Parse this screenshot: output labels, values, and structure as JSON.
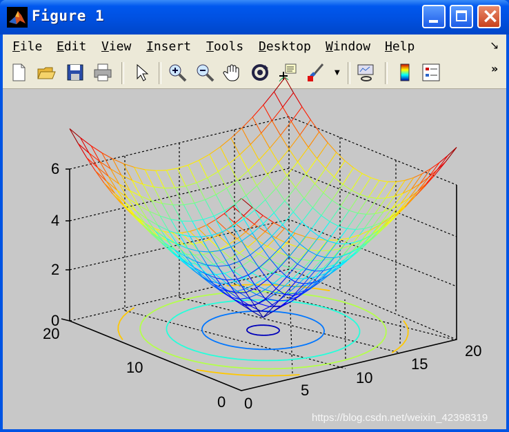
{
  "window": {
    "title": "Figure 1"
  },
  "menu": [
    {
      "label": "File",
      "mnemonic": "F",
      "rest": "ile"
    },
    {
      "label": "Edit",
      "mnemonic": "E",
      "rest": "dit"
    },
    {
      "label": "View",
      "mnemonic": "V",
      "rest": "iew"
    },
    {
      "label": "Insert",
      "mnemonic": "I",
      "rest": "nsert"
    },
    {
      "label": "Tools",
      "mnemonic": "T",
      "rest": "ools"
    },
    {
      "label": "Desktop",
      "mnemonic": "D",
      "rest": "esktop"
    },
    {
      "label": "Window",
      "mnemonic": "W",
      "rest": "indow"
    },
    {
      "label": "Help",
      "mnemonic": "H",
      "rest": "elp"
    }
  ],
  "toolbar_icons": [
    "new-figure-icon",
    "open-folder-icon",
    "save-icon",
    "print-icon",
    "select-arrow-icon",
    "zoom-in-icon",
    "zoom-out-icon",
    "pan-hand-icon",
    "rotate-3d-icon",
    "data-cursor-icon",
    "brush-icon",
    "link-plot-icon",
    "colorbar-icon",
    "legend-icon"
  ],
  "plot": {
    "z_ticks": [
      "0",
      "2",
      "4",
      "6"
    ],
    "y_ticks": [
      "0",
      "10",
      "20"
    ],
    "x_ticks": [
      "0",
      "5",
      "10",
      "15",
      "20"
    ],
    "surface": "mesh",
    "contour": "on",
    "colormap": "jet",
    "grid": true
  },
  "watermark": "https://blog.csdn.net/weixin_42398319"
}
